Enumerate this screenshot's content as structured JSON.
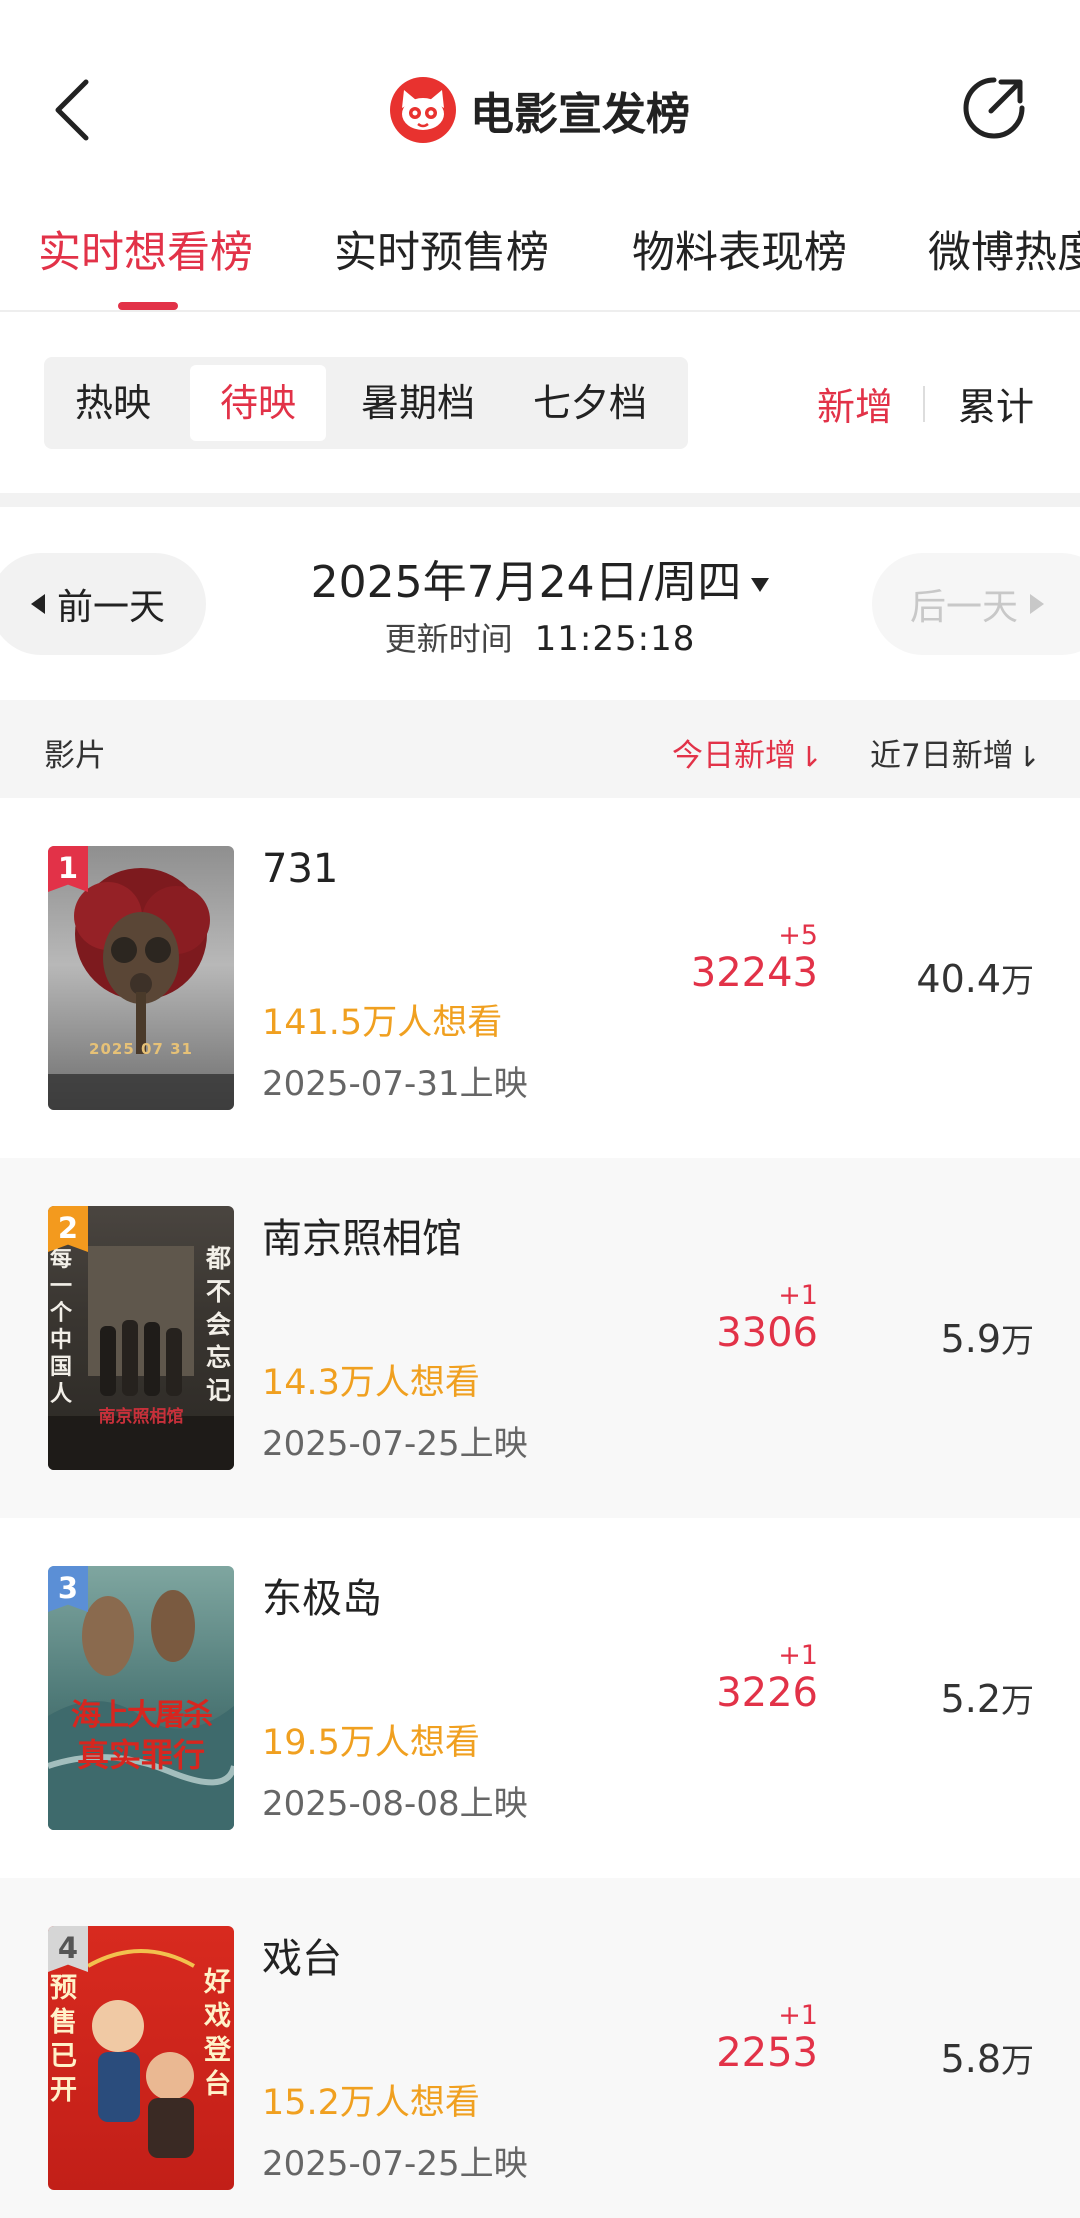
{
  "header": {
    "title": "电影宣发榜",
    "back_icon": "chevron-left-icon",
    "share_icon": "share-icon",
    "logo_icon": "cat-logo-icon"
  },
  "tabs": [
    {
      "label": "实时想看榜",
      "active": true
    },
    {
      "label": "实时预售榜",
      "active": false
    },
    {
      "label": "物料表现榜",
      "active": false
    },
    {
      "label": "微博热度",
      "active": false
    }
  ],
  "segments": [
    {
      "label": "热映",
      "active": false
    },
    {
      "label": "待映",
      "active": true
    },
    {
      "label": "暑期档",
      "active": false
    },
    {
      "label": "七夕档",
      "active": false
    }
  ],
  "mode_toggle": {
    "new": "新增",
    "total": "累计",
    "active": "新增"
  },
  "date_nav": {
    "prev_label": "前一天",
    "next_label": "后一天",
    "date_year": "2025",
    "date_year_suffix": "年",
    "date_month": "7",
    "date_month_suffix": "月",
    "date_day": "24",
    "date_day_suffix": "日/周四",
    "update_label": "更新时间",
    "update_time": "11:25:18"
  },
  "table": {
    "col_movie": "影片",
    "col_today": "今日新增",
    "col_week": "近7日新增",
    "sort_icon": "sort-arrow-icon"
  },
  "movies": [
    {
      "rank": "1",
      "name": "731",
      "want": "141.5万人想看",
      "release": "2025-07-31上映",
      "delta": "+5",
      "today": "32243",
      "week_num": "40.4",
      "week_unit": "万",
      "rank_color": "#e23248",
      "poster_date": "2025 07 31"
    },
    {
      "rank": "2",
      "name": "南京照相馆",
      "want": "14.3万人想看",
      "release": "2025-07-25上映",
      "delta": "+1",
      "today": "3306",
      "week_num": "5.9",
      "week_unit": "万",
      "rank_color": "#f39a1e",
      "poster_left": "每一个中国人",
      "poster_right": "都不会忘记",
      "poster_title": "南京照相馆"
    },
    {
      "rank": "3",
      "name": "东极岛",
      "want": "19.5万人想看",
      "release": "2025-08-08上映",
      "delta": "+1",
      "today": "3226",
      "week_num": "5.2",
      "week_unit": "万",
      "rank_color": "#5b8fd6",
      "poster_line1": "海上大屠杀",
      "poster_line2": "真实罪行"
    },
    {
      "rank": "4",
      "name": "戏台",
      "want": "15.2万人想看",
      "release": "2025-07-25上映",
      "delta": "+1",
      "today": "2253",
      "week_num": "5.8",
      "week_unit": "万",
      "rank_color": "#cfcfcf",
      "poster_left": "预售已开",
      "poster_right": "好戏登台"
    }
  ],
  "colors": {
    "accent": "#e23248",
    "want": "#f0a020"
  }
}
